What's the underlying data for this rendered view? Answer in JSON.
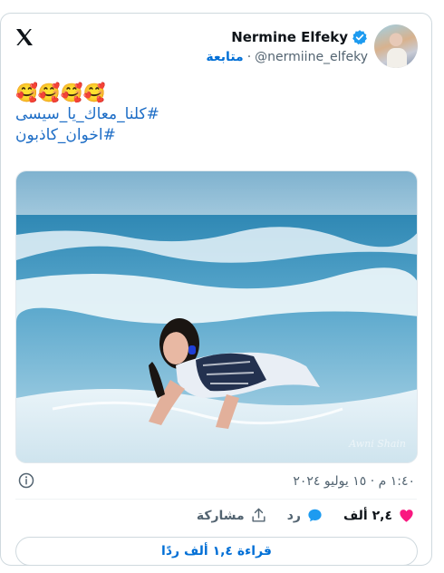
{
  "author": {
    "name": "Nermine Elfeky",
    "handle": "@nermiine_elfeky",
    "separator": "·",
    "follow_label": "متابعة"
  },
  "post": {
    "emojis": "🥰🥰🥰🥰",
    "hashtags": [
      "#كلنا_معاك_يا_سيسى",
      "#اخوان_كاذبون"
    ],
    "timestamp": "١:٤٠ م · ١٥ يوليو ٢٠٢٤"
  },
  "actions": {
    "likes_count": "٢,٤ ألف",
    "reply_label": "رد",
    "share_label": "مشاركة"
  },
  "read_replies_label": "قراءة ١,٤ ألف ردًا",
  "photo": {
    "watermark": "Awni Shain"
  },
  "colors": {
    "brand_blue": "#1d9bf0",
    "link_blue": "#006fd6",
    "like_pink": "#f91880"
  },
  "icons": {
    "logo": "x-logo-icon",
    "verified": "verified-badge-icon",
    "info": "info-icon",
    "like": "heart-icon",
    "reply": "speech-bubble-icon",
    "share": "share-upload-icon"
  }
}
